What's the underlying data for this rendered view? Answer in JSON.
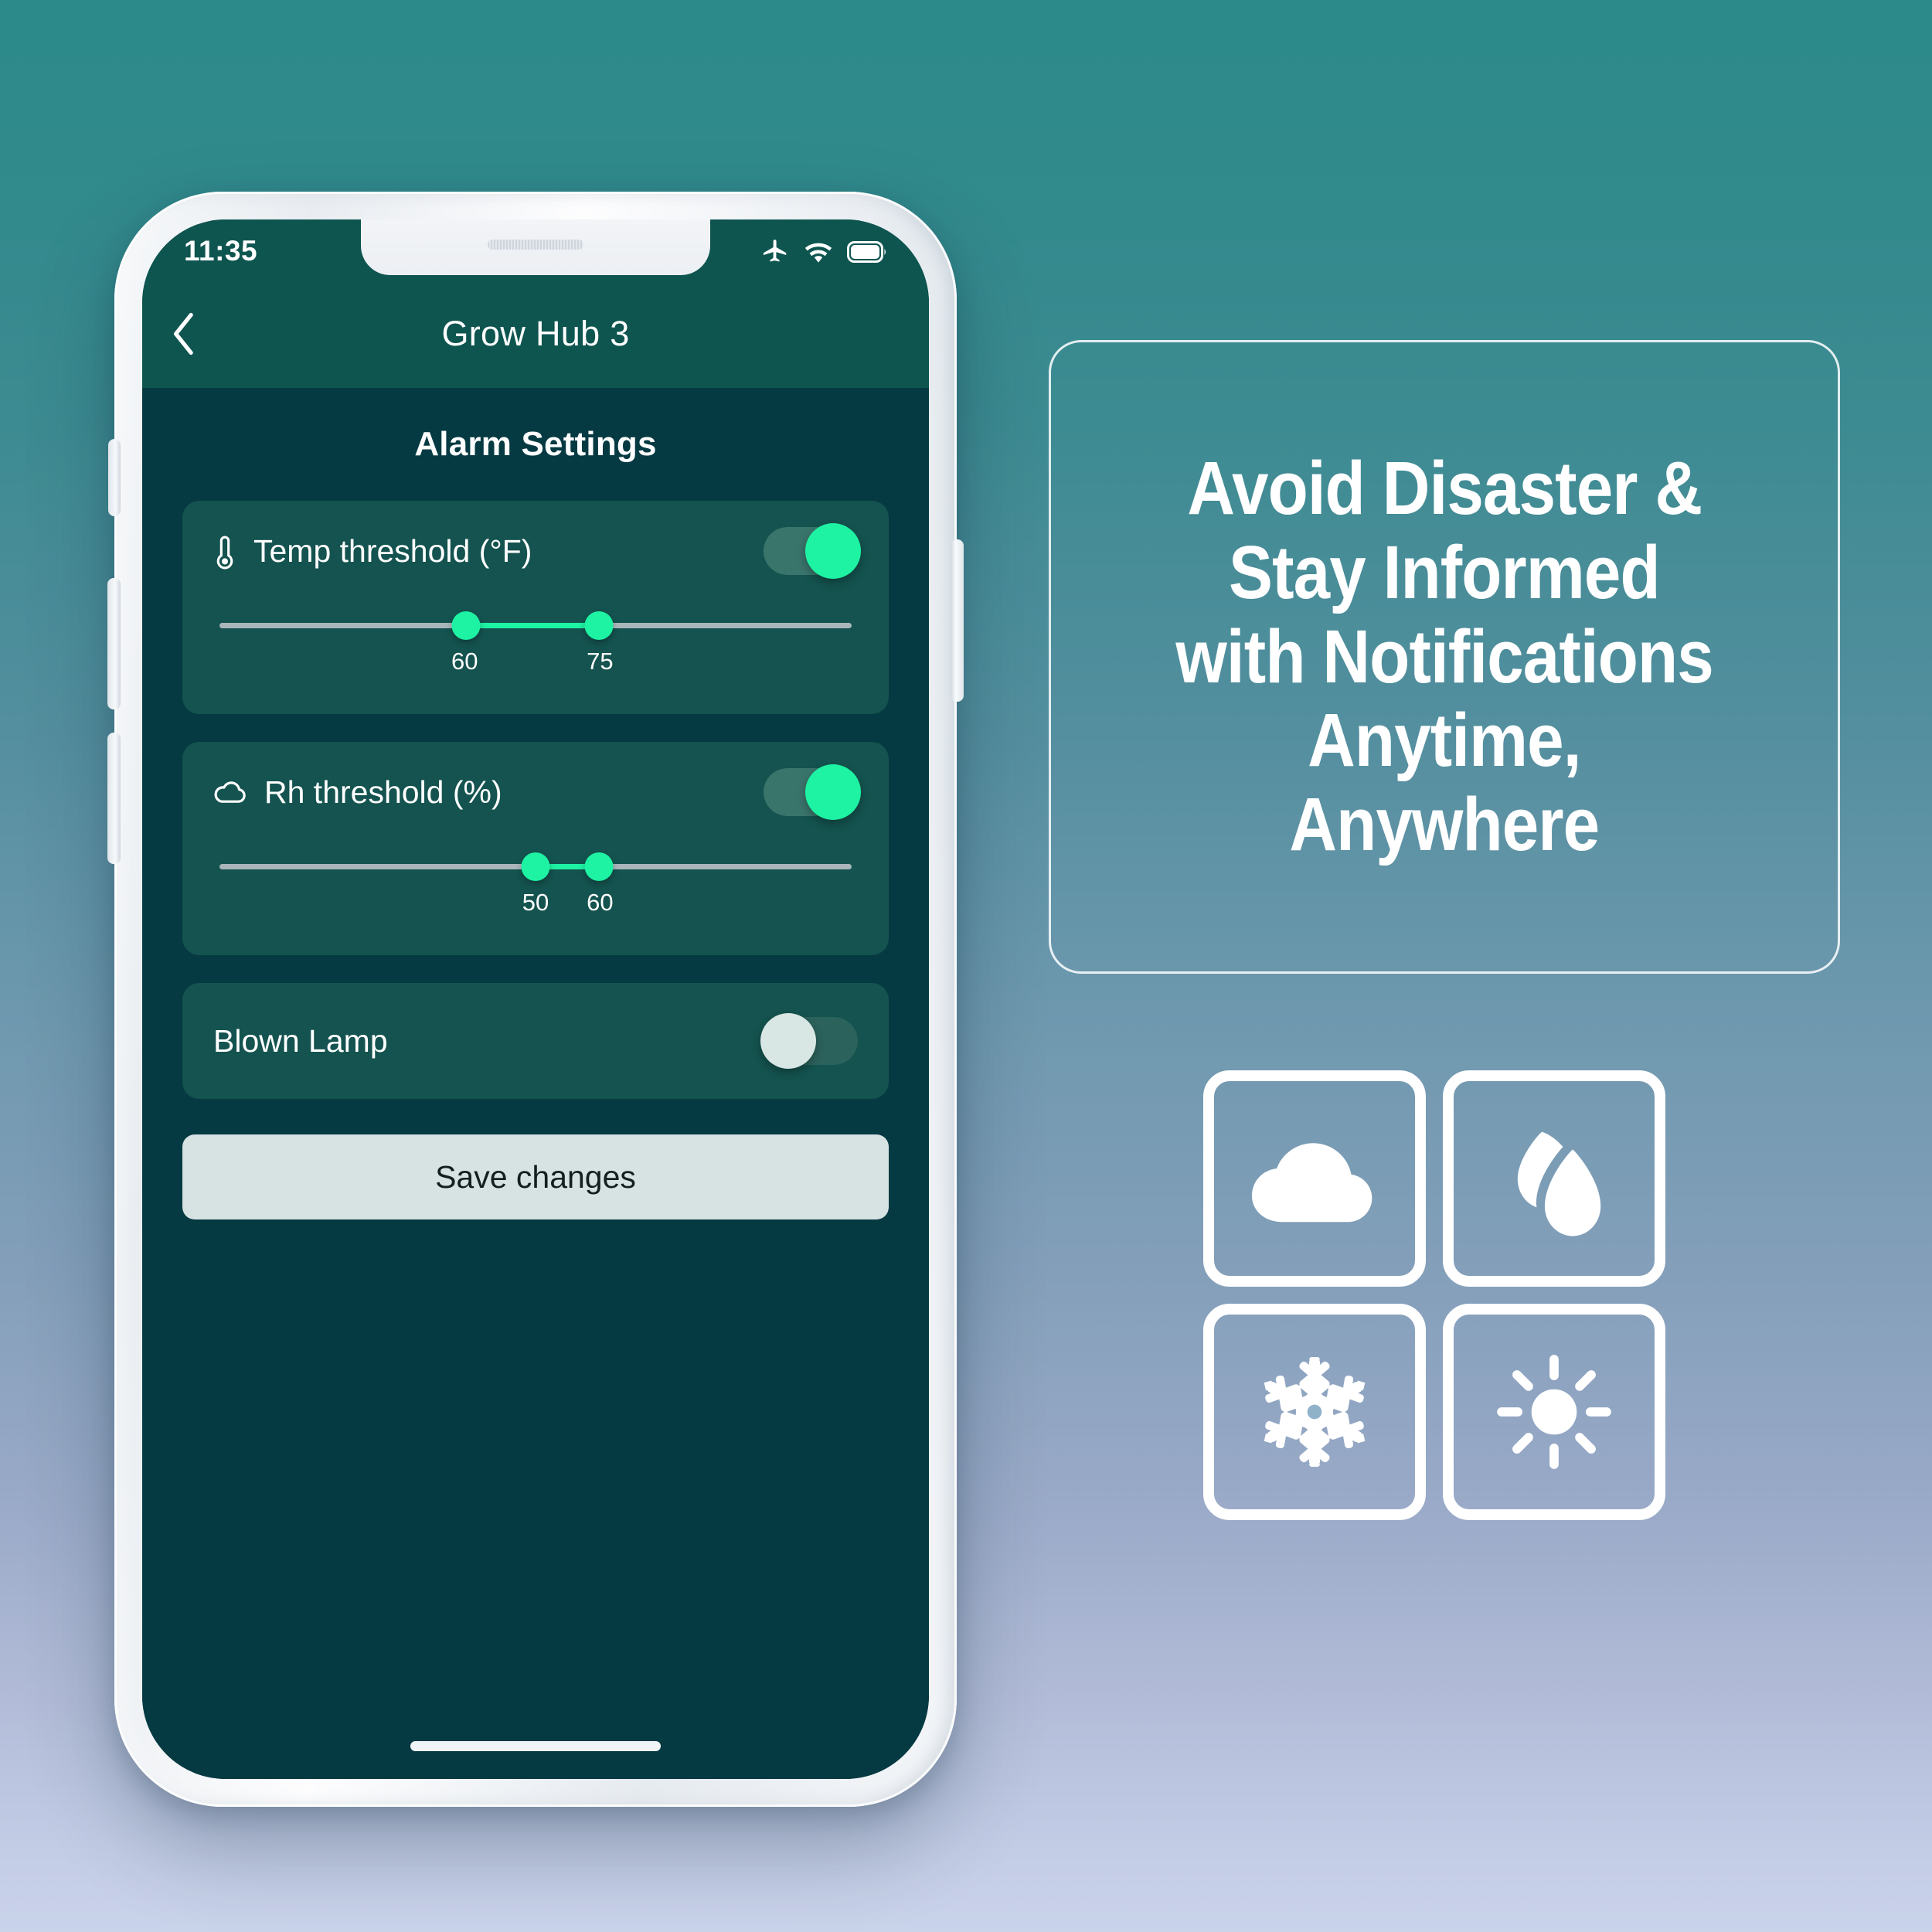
{
  "phone": {
    "status_bar": {
      "time": "11:35",
      "icons": [
        "airplane-icon",
        "wifi-icon",
        "battery-icon"
      ]
    },
    "nav": {
      "back_icon": "chevron-left-icon",
      "title": "Grow Hub 3"
    },
    "screen": {
      "section_title": "Alarm Settings",
      "cards": [
        {
          "icon": "thermometer-icon",
          "label": "Temp threshold (°F)",
          "toggle_state": "on",
          "slider": {
            "min_value": "60",
            "max_value": "75",
            "low_pct": 39,
            "high_pct": 60
          }
        },
        {
          "icon": "cloud-icon",
          "label": "Rh threshold (%)",
          "toggle_state": "on",
          "slider": {
            "min_value": "50",
            "max_value": "60",
            "low_pct": 50,
            "high_pct": 60
          }
        },
        {
          "icon": "none",
          "label": "Blown Lamp",
          "toggle_state": "off",
          "slider": null
        }
      ],
      "save_button": "Save changes"
    }
  },
  "promo": {
    "headline_lines": [
      "Avoid Disaster &",
      "Stay Informed",
      "with Notifications",
      "Anytime,",
      "Anywhere"
    ],
    "feature_icons": [
      "cloud-icon",
      "humidity-droplet-icon",
      "snowflake-icon",
      "sun-icon"
    ]
  },
  "colors": {
    "accent_green": "#1ef2a3",
    "app_background": "#063a42",
    "nav_background": "#0e5550",
    "card_background": "#14534f",
    "save_button": "#d7e3e2",
    "gradient_top": "#2c8a8a",
    "gradient_bottom": "#c9d3ea"
  }
}
